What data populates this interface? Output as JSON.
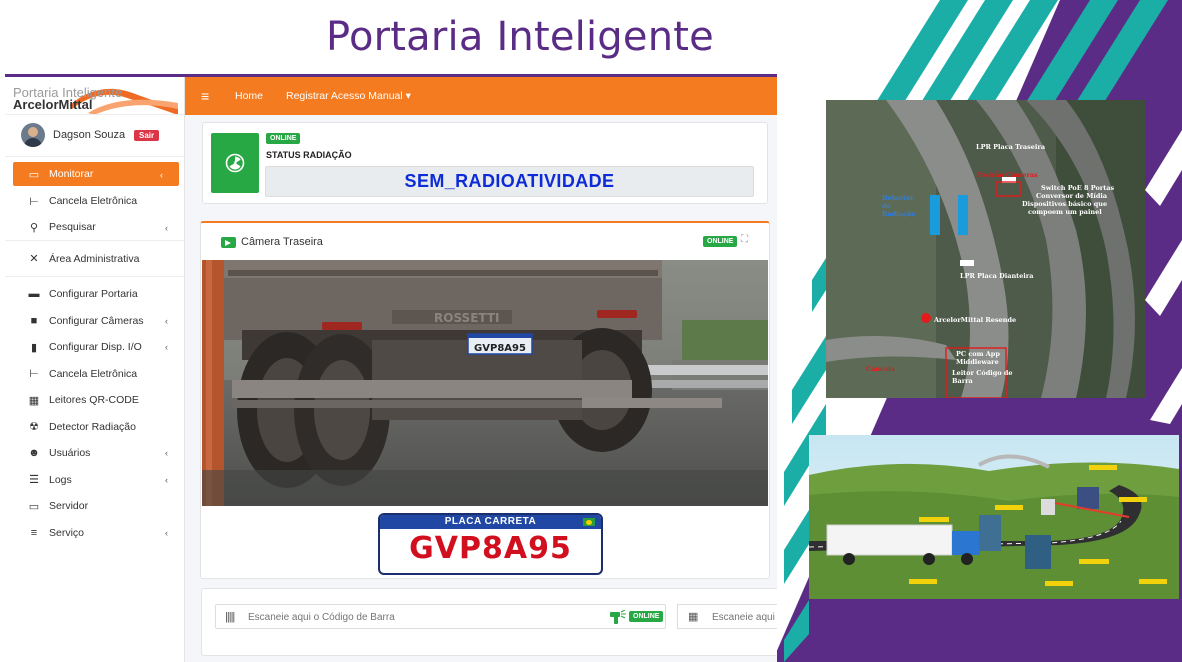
{
  "slide": {
    "title": "Portaria Inteligente"
  },
  "app": {
    "brand": {
      "subtitle": "Portaria Inteligente",
      "name": "ArcelorMittal"
    },
    "user": {
      "name": "Dagson Souza",
      "logout": "Sair"
    },
    "topbar": {
      "home": "Home",
      "manual_access": "Registrar Acesso Manual ▾"
    },
    "sidebar": {
      "items": [
        {
          "label": "Monitorar",
          "icon": "monitor-icon"
        },
        {
          "label": "Cancela Eletrônica",
          "icon": "barrier-icon"
        },
        {
          "label": "Pesquisar",
          "icon": "search-icon"
        },
        {
          "label": "Área Administrativa",
          "icon": "tools-icon"
        },
        {
          "label": "Configurar Portaria",
          "icon": "truck-icon"
        },
        {
          "label": "Configurar Câmeras",
          "icon": "video-icon"
        },
        {
          "label": "Configurar Disp. I/O",
          "icon": "chip-icon"
        },
        {
          "label": "Cancela Eletrônica",
          "icon": "barrier-icon"
        },
        {
          "label": "Leitores QR-CODE",
          "icon": "qrcode-icon"
        },
        {
          "label": "Detector Radiação",
          "icon": "radiation-icon"
        },
        {
          "label": "Usuários",
          "icon": "users-icon"
        },
        {
          "label": "Logs",
          "icon": "list-icon"
        },
        {
          "label": "Servidor",
          "icon": "laptop-icon"
        },
        {
          "label": "Serviço",
          "icon": "server-icon"
        }
      ]
    },
    "radiation": {
      "badge": "ONLINE",
      "label": "STATUS RADIAÇÃO",
      "value": "SEM_RADIOATIVIDADE"
    },
    "camera": {
      "title": "Câmera Traseira",
      "badge": "ONLINE",
      "truck_plate": "GVP8A95",
      "truck_brand": "ROSSETTI"
    },
    "plate": {
      "header": "PLACA CARRETA",
      "number": "GVP8A95"
    },
    "scanner": {
      "placeholder": "Escaneie aqui o Código de Barra",
      "badge": "ONLINE",
      "qr_placeholder": "Escaneie aqui"
    }
  },
  "aerial_map": {
    "labels": {
      "lpr_rear": "LPR Placa Traseira",
      "position_cameras": "Posição Câmeras",
      "switch": "Switch PoE 8 Portas",
      "converter": "Conversor de Mídia",
      "devices": "Dispositivos básico que",
      "panel": "compoem um painel",
      "detector_1": "Detector",
      "detector_2": "de",
      "detector_3": "Radiação",
      "lpr_front": "LPR Placa Dianteira",
      "location": "ArcelorMittal Resende",
      "pc": "PC com App",
      "middleware": "Middleware",
      "reader": "Leitor Código de",
      "reader_2": "Barra",
      "cancela": "Cancela"
    }
  },
  "colors": {
    "purple": "#5b2c86",
    "teal": "#1aaea6",
    "orange": "#f47b20",
    "online_green": "#28a745",
    "radiation_text": "#0d2bd6",
    "plate_red": "#d10f1f"
  }
}
